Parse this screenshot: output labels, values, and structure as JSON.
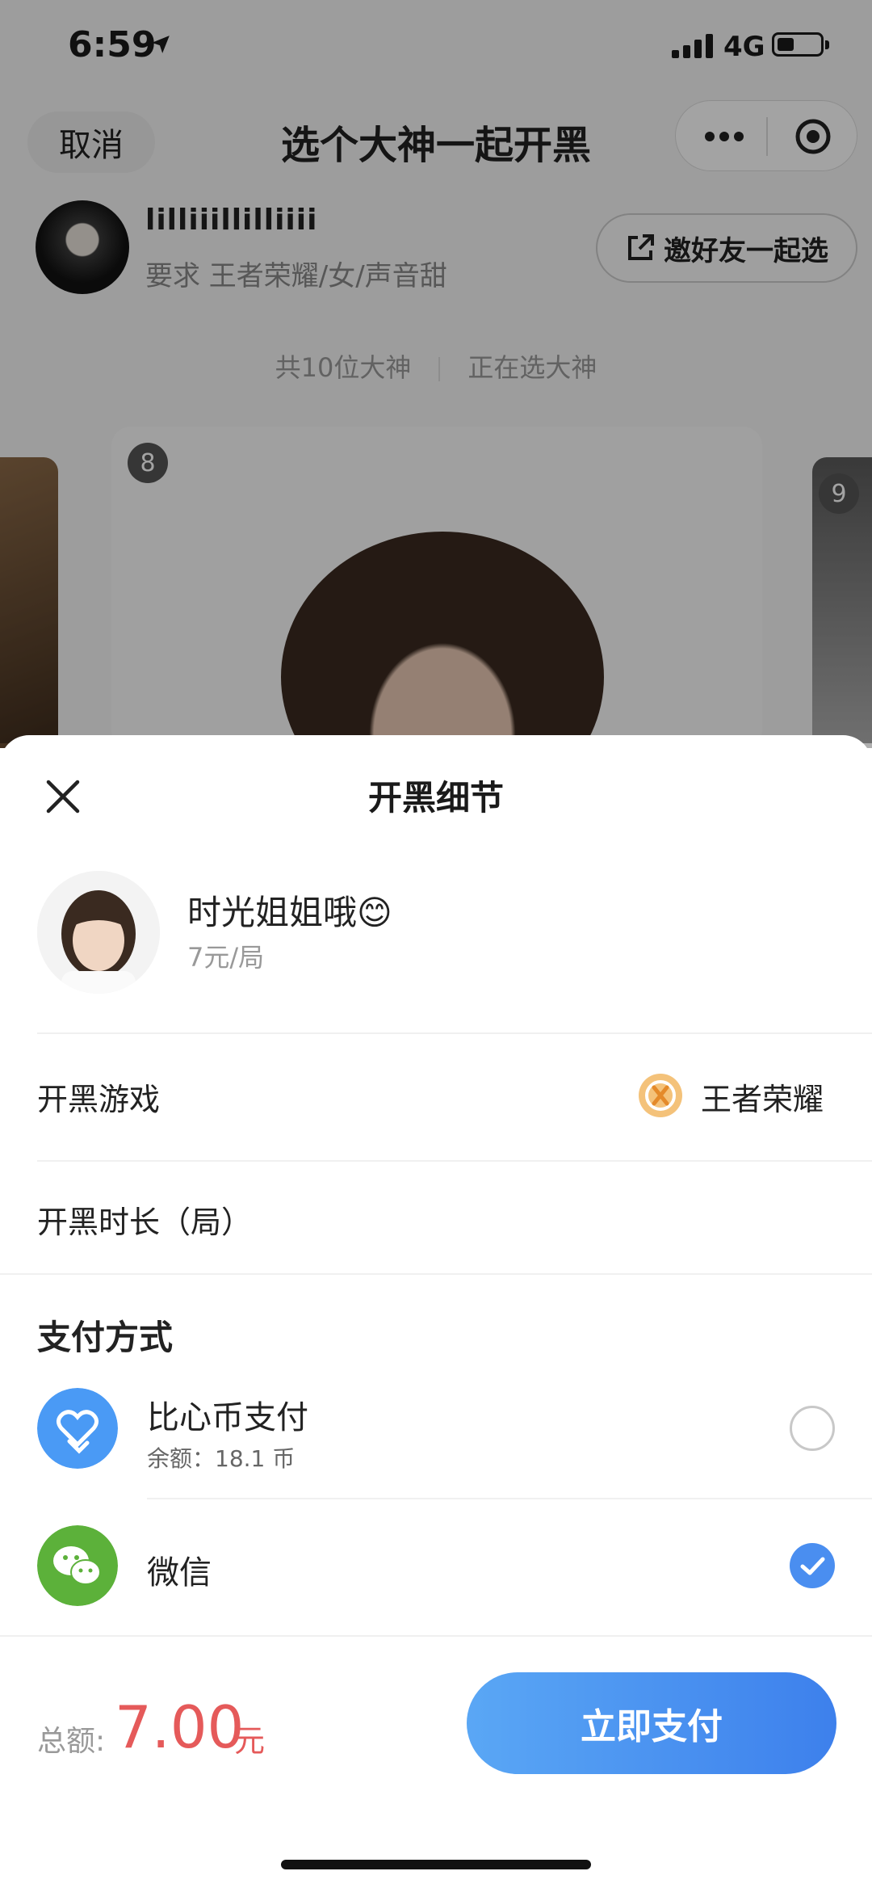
{
  "status_bar": {
    "time": "6:59",
    "network": "4G",
    "battery_level": 0.4
  },
  "nav": {
    "cancel_label": "取消",
    "title": "选个大神一起开黑"
  },
  "request": {
    "username": "lilliiillilliiii",
    "requirements": "要求 王者荣耀/女/声音甜",
    "invite_label": "邀好友一起选"
  },
  "selection": {
    "total_label": "共10位大神",
    "status_label": "正在选大神",
    "card_current": "8",
    "card_next": "9"
  },
  "sheet": {
    "title": "开黑细节",
    "player": {
      "name": "时光姐姐哦😊",
      "price": "7元/局"
    },
    "game_label": "开黑游戏",
    "game_name": "王者荣耀",
    "duration_label": "开黑时长（局）",
    "payment_title": "支付方式",
    "payment_options": [
      {
        "name": "比心币支付",
        "sub": "余额：18.1 币",
        "selected": false,
        "icon": "heart-coin-icon",
        "color": "#4a9af5"
      },
      {
        "name": "微信",
        "sub": "",
        "selected": true,
        "icon": "wechat-icon",
        "color": "#5cb13a"
      }
    ],
    "total_label": "总额:",
    "total_value": "7.00",
    "total_unit": "元",
    "pay_button": "立即支付"
  },
  "colors": {
    "accent": "#4a8ef0",
    "price": "#e55a5a",
    "wechat": "#5cb13a"
  }
}
